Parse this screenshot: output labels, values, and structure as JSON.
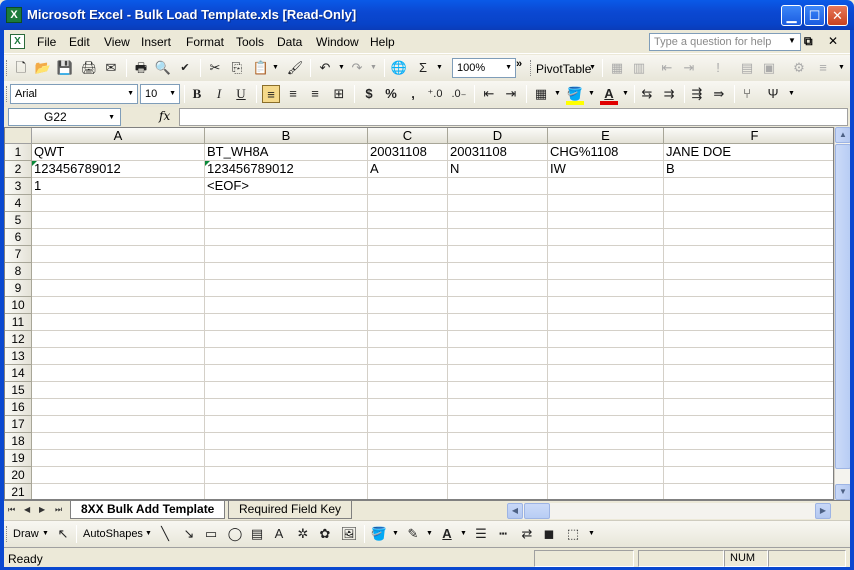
{
  "window": {
    "title": "Microsoft Excel - Bulk Load Template.xls  [Read-Only]",
    "app_icon_glyph": "X",
    "controls": [
      "minimize",
      "maximize",
      "close"
    ]
  },
  "menu": {
    "items": [
      "File",
      "Edit",
      "View",
      "Insert",
      "Format",
      "Tools",
      "Data",
      "Window",
      "Help"
    ],
    "ask_placeholder": "Type a question for help"
  },
  "standard_toolbar": {
    "zoom": "100%",
    "pivot_label": "PivotTable"
  },
  "formatting_toolbar": {
    "font_name": "Arial",
    "font_size": "10",
    "font_color": "#e00000",
    "fill_color": "#ffff00"
  },
  "formula_bar": {
    "name_box": "G22",
    "fx_label": "fx",
    "content": ""
  },
  "grid": {
    "columns": [
      "A",
      "B",
      "C",
      "D",
      "E",
      "F"
    ],
    "rows": [
      {
        "num": "1",
        "cells": [
          "QWT",
          "BT_WH8A",
          "20031108",
          "20031108",
          "CHG%1108",
          "JANE DOE"
        ]
      },
      {
        "num": "2",
        "cells": [
          "123456789012",
          "123456789012",
          "A",
          "N",
          "IW",
          "B"
        ]
      },
      {
        "num": "3",
        "cells": [
          "1",
          "<EOF>",
          "",
          "",
          "",
          ""
        ]
      },
      {
        "num": "4",
        "cells": [
          "",
          "",
          "",
          "",
          "",
          ""
        ]
      },
      {
        "num": "5",
        "cells": [
          "",
          "",
          "",
          "",
          "",
          ""
        ]
      },
      {
        "num": "6",
        "cells": [
          "",
          "",
          "",
          "",
          "",
          ""
        ]
      },
      {
        "num": "7",
        "cells": [
          "",
          "",
          "",
          "",
          "",
          ""
        ]
      },
      {
        "num": "8",
        "cells": [
          "",
          "",
          "",
          "",
          "",
          ""
        ]
      },
      {
        "num": "9",
        "cells": [
          "",
          "",
          "",
          "",
          "",
          ""
        ]
      },
      {
        "num": "10",
        "cells": [
          "",
          "",
          "",
          "",
          "",
          ""
        ]
      },
      {
        "num": "11",
        "cells": [
          "",
          "",
          "",
          "",
          "",
          ""
        ]
      },
      {
        "num": "12",
        "cells": [
          "",
          "",
          "",
          "",
          "",
          ""
        ]
      },
      {
        "num": "13",
        "cells": [
          "",
          "",
          "",
          "",
          "",
          ""
        ]
      },
      {
        "num": "14",
        "cells": [
          "",
          "",
          "",
          "",
          "",
          ""
        ]
      },
      {
        "num": "15",
        "cells": [
          "",
          "",
          "",
          "",
          "",
          ""
        ]
      },
      {
        "num": "16",
        "cells": [
          "",
          "",
          "",
          "",
          "",
          ""
        ]
      },
      {
        "num": "17",
        "cells": [
          "",
          "",
          "",
          "",
          "",
          ""
        ]
      },
      {
        "num": "18",
        "cells": [
          "",
          "",
          "",
          "",
          "",
          ""
        ]
      },
      {
        "num": "19",
        "cells": [
          "",
          "",
          "",
          "",
          "",
          ""
        ]
      },
      {
        "num": "20",
        "cells": [
          "",
          "",
          "",
          "",
          "",
          ""
        ]
      },
      {
        "num": "21",
        "cells": [
          "",
          "",
          "",
          "",
          "",
          ""
        ]
      }
    ],
    "flagged_cells": [
      "A2",
      "B2"
    ]
  },
  "sheets": {
    "tabs": [
      "8XX Bulk Add Template",
      "Required Field Key"
    ],
    "active": "8XX Bulk Add Template"
  },
  "drawing_toolbar": {
    "draw_label": "Draw",
    "autoshapes_label": "AutoShapes"
  },
  "status": {
    "text": "Ready",
    "num_indicator": "NUM"
  }
}
